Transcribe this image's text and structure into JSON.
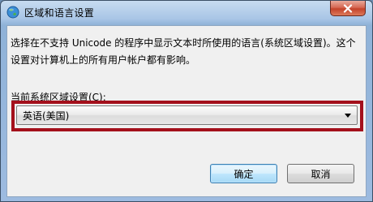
{
  "window": {
    "title": "区域和语言设置"
  },
  "colors": {
    "highlight_border": "#a4101c",
    "title_bar": "#a9c6e6",
    "close_button": "#c4432b"
  },
  "dialog": {
    "description": "选择在不支持 Unicode 的程序中显示文本时所使用的语言(系统区域设置)。这个设置对计算机上的所有用户帐户都有影响。",
    "locale_label": "当前系统区域设置(C):",
    "locale_value": "英语(美国)"
  },
  "buttons": {
    "ok": "确定",
    "cancel": "取消"
  },
  "icons": {
    "app": "globe-icon",
    "close": "close-icon",
    "dropdown": "chevron-down-icon"
  }
}
